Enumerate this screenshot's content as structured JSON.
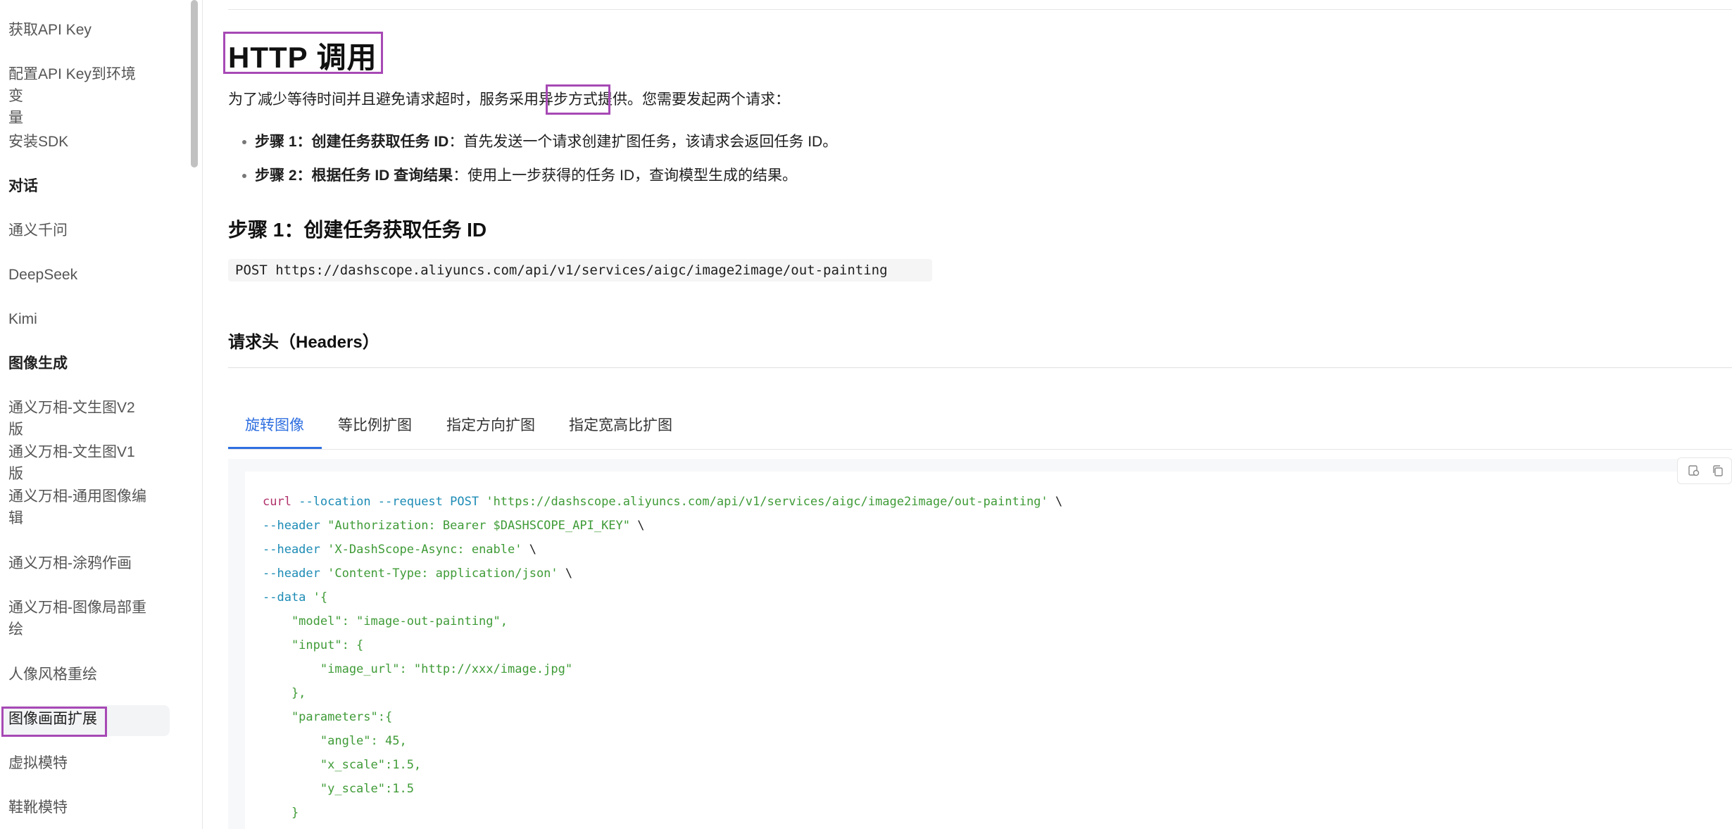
{
  "sidebar": {
    "items": [
      {
        "label": "获取API Key",
        "group": false
      },
      {
        "label": "配置API Key到环境变\n量",
        "group": false
      },
      {
        "label": "安装SDK",
        "group": false
      },
      {
        "label": "对话",
        "group": true
      },
      {
        "label": "通义千问",
        "group": false
      },
      {
        "label": "DeepSeek",
        "group": false
      },
      {
        "label": "Kimi",
        "group": false
      },
      {
        "label": "图像生成",
        "group": true
      },
      {
        "label": "通义万相-文生图V2版",
        "group": false
      },
      {
        "label": "通义万相-文生图V1版",
        "group": false
      },
      {
        "label": "通义万相-通用图像编\n辑",
        "group": false
      },
      {
        "label": "通义万相-涂鸦作画",
        "group": false
      },
      {
        "label": "通义万相-图像局部重\n绘",
        "group": false
      },
      {
        "label": "人像风格重绘",
        "group": false
      },
      {
        "label": "图像画面扩展",
        "group": false,
        "active": true
      },
      {
        "label": "虚拟模特",
        "group": false
      },
      {
        "label": "鞋靴模特",
        "group": false
      }
    ]
  },
  "main": {
    "title": "HTTP 调用",
    "intro_before": "为了减少等待时间并且避免请求超时，服务采用",
    "intro_highlight": "异步方式",
    "intro_after": "提供。您需要发起两个请求：",
    "bullets": [
      {
        "bold": "步骤 1：创建任务获取任务 ID",
        "text": "：首先发送一个请求创建扩图任务，该请求会返回任务 ID。"
      },
      {
        "bold": "步骤 2：根据任务 ID 查询结果",
        "text": "：使用上一步获得的任务 ID，查询模型生成的结果。"
      }
    ],
    "step1_heading": "步骤 1：创建任务获取任务 ID",
    "endpoint": "POST https://dashscope.aliyuncs.com/api/v1/services/aigc/image2image/out-painting",
    "headers_heading": "请求头（Headers）",
    "tabs": [
      "旋转图像",
      "等比例扩图",
      "指定方向扩图",
      "指定宽高比扩图"
    ],
    "active_tab": 0,
    "code_lines": [
      [
        [
          "cmd",
          "curl"
        ],
        [
          "def",
          " "
        ],
        [
          "flag",
          "--location --request POST"
        ],
        [
          "def",
          " "
        ],
        [
          "str",
          "'https://dashscope.aliyuncs.com/api/v1/services/aigc/image2image/out-painting'"
        ],
        [
          "def",
          " \\"
        ]
      ],
      [
        [
          "flag",
          "--header"
        ],
        [
          "def",
          " "
        ],
        [
          "str",
          "\"Authorization: Bearer $DASHSCOPE_API_KEY\""
        ],
        [
          "def",
          " \\"
        ]
      ],
      [
        [
          "flag",
          "--header"
        ],
        [
          "def",
          " "
        ],
        [
          "str",
          "'X-DashScope-Async: enable'"
        ],
        [
          "def",
          " \\"
        ]
      ],
      [
        [
          "flag",
          "--header"
        ],
        [
          "def",
          " "
        ],
        [
          "str",
          "'Content-Type: application/json'"
        ],
        [
          "def",
          " \\"
        ]
      ],
      [
        [
          "flag",
          "--data"
        ],
        [
          "def",
          " "
        ],
        [
          "str",
          "'{"
        ]
      ],
      [
        [
          "str",
          "    \"model\": \"image-out-painting\","
        ]
      ],
      [
        [
          "str",
          "    \"input\": {"
        ]
      ],
      [
        [
          "str",
          "        \"image_url\": \"http://xxx/image.jpg\""
        ]
      ],
      [
        [
          "str",
          "    },"
        ]
      ],
      [
        [
          "str",
          "    \"parameters\":{"
        ]
      ],
      [
        [
          "str",
          "        \"angle\": 45,"
        ]
      ],
      [
        [
          "str",
          "        \"x_scale\":1.5,"
        ]
      ],
      [
        [
          "str",
          "        \"y_scale\":1.5"
        ]
      ],
      [
        [
          "str",
          "    }"
        ]
      ]
    ]
  }
}
